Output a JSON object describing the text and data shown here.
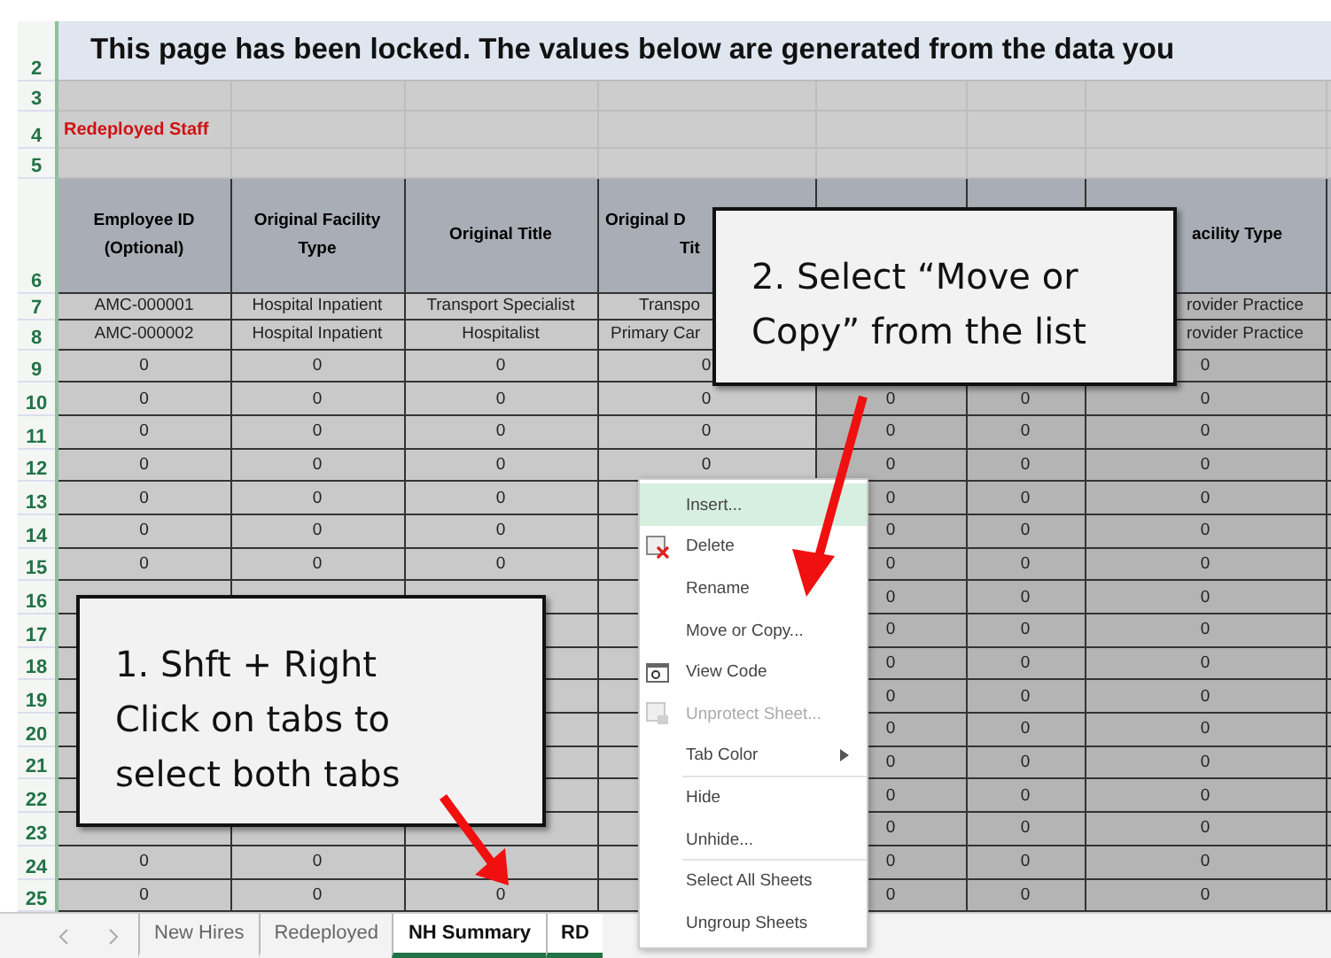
{
  "title_row": {
    "number": "2",
    "text": "This page has been locked.  The values below are generated from the data you"
  },
  "blank_rows": [
    {
      "number": "3"
    },
    {
      "number": "4",
      "label": "Redeployed Staff"
    },
    {
      "number": "5"
    }
  ],
  "header_row": {
    "number": "6",
    "columns": [
      {
        "lines": [
          "Employee ID (Optional)"
        ]
      },
      {
        "lines": [
          "Original Facility Type"
        ]
      },
      {
        "lines": [
          "Original Title"
        ]
      },
      {
        "lines": [
          "Original D",
          "Tit"
        ]
      },
      null,
      null,
      {
        "lines": [
          "acility Type"
        ]
      }
    ]
  },
  "rows": [
    {
      "number": "7",
      "cells": [
        "AMC-000001",
        "Hospital Inpatient",
        "Transport Specialist",
        "Transpo",
        null,
        null,
        "rovider Practice"
      ]
    },
    {
      "number": "8",
      "cells": [
        "AMC-000002",
        "Hospital Inpatient",
        "Hospitalist",
        "Primary Car",
        null,
        null,
        "rovider Practice"
      ]
    },
    {
      "number": "9",
      "cells": [
        "0",
        "0",
        "0",
        "0",
        null,
        null,
        "0"
      ]
    },
    {
      "number": "10",
      "cells": [
        "0",
        "0",
        "0",
        "0",
        "0",
        "0",
        "0"
      ]
    },
    {
      "number": "11",
      "cells": [
        "0",
        "0",
        "0",
        "0",
        "0",
        "0",
        "0"
      ]
    },
    {
      "number": "12",
      "cells": [
        "0",
        "0",
        "0",
        "0",
        "0",
        "0",
        "0"
      ]
    },
    {
      "number": "13",
      "cells": [
        "0",
        "0",
        "0",
        null,
        "0",
        "0",
        "0"
      ]
    },
    {
      "number": "14",
      "cells": [
        "0",
        "0",
        "0",
        null,
        "0",
        "0",
        "0"
      ]
    },
    {
      "number": "15",
      "cells": [
        "0",
        "0",
        "0",
        null,
        "0",
        "0",
        "0"
      ]
    },
    {
      "number": "16",
      "cells": [
        null,
        null,
        null,
        null,
        "0",
        "0",
        "0"
      ]
    },
    {
      "number": "17",
      "cells": [
        null,
        null,
        null,
        null,
        "0",
        "0",
        "0"
      ]
    },
    {
      "number": "18",
      "cells": [
        null,
        null,
        null,
        null,
        "0",
        "0",
        "0"
      ]
    },
    {
      "number": "19",
      "cells": [
        null,
        null,
        null,
        null,
        "0",
        "0",
        "0"
      ]
    },
    {
      "number": "20",
      "cells": [
        null,
        null,
        null,
        null,
        "0",
        "0",
        "0"
      ]
    },
    {
      "number": "21",
      "cells": [
        null,
        null,
        null,
        null,
        "0",
        "0",
        "0"
      ]
    },
    {
      "number": "22",
      "cells": [
        null,
        null,
        null,
        null,
        "0",
        "0",
        "0"
      ]
    },
    {
      "number": "23",
      "cells": [
        null,
        null,
        null,
        null,
        "0",
        "0",
        "0"
      ]
    },
    {
      "number": "24",
      "cells": [
        "0",
        "0",
        null,
        null,
        "0",
        "0",
        "0"
      ]
    },
    {
      "number": "25",
      "cells": [
        "0",
        "0",
        "0",
        null,
        "0",
        "0",
        "0"
      ]
    }
  ],
  "sheet_tabs": [
    {
      "label": "New Hires",
      "selected": false
    },
    {
      "label": "Redeployed",
      "selected": false
    },
    {
      "label": "NH Summary",
      "selected": true
    },
    {
      "label": "RD",
      "selected": true
    }
  ],
  "context_menu": [
    {
      "label": "Insert...",
      "highlighted": true,
      "disabled": false
    },
    {
      "label": "Delete",
      "kind": "delete",
      "highlighted": false,
      "disabled": false
    },
    {
      "label": "Rename",
      "highlighted": false,
      "disabled": false
    },
    {
      "label": "Move or Copy...",
      "highlighted": false,
      "disabled": false
    },
    {
      "label": "View Code",
      "kind": "code",
      "highlighted": false,
      "disabled": false
    },
    {
      "label": "Unprotect Sheet...",
      "kind": "unprotect",
      "highlighted": false,
      "disabled": true
    },
    {
      "label": "Tab Color",
      "submenu": true,
      "highlighted": false,
      "disabled": false
    },
    {
      "label": "Hide",
      "separator_before": true,
      "highlighted": false,
      "disabled": false
    },
    {
      "label": "Unhide...",
      "highlighted": false,
      "disabled": false
    },
    {
      "label": "Select All Sheets",
      "separator_before": true,
      "highlighted": false,
      "disabled": false
    },
    {
      "label": "Ungroup Sheets",
      "highlighted": false,
      "disabled": false
    }
  ],
  "callouts": [
    {
      "text": "1. Shft + Right Click on tabs to select both tabs"
    },
    {
      "text": "2. Select “Move or Copy” from the list"
    }
  ]
}
